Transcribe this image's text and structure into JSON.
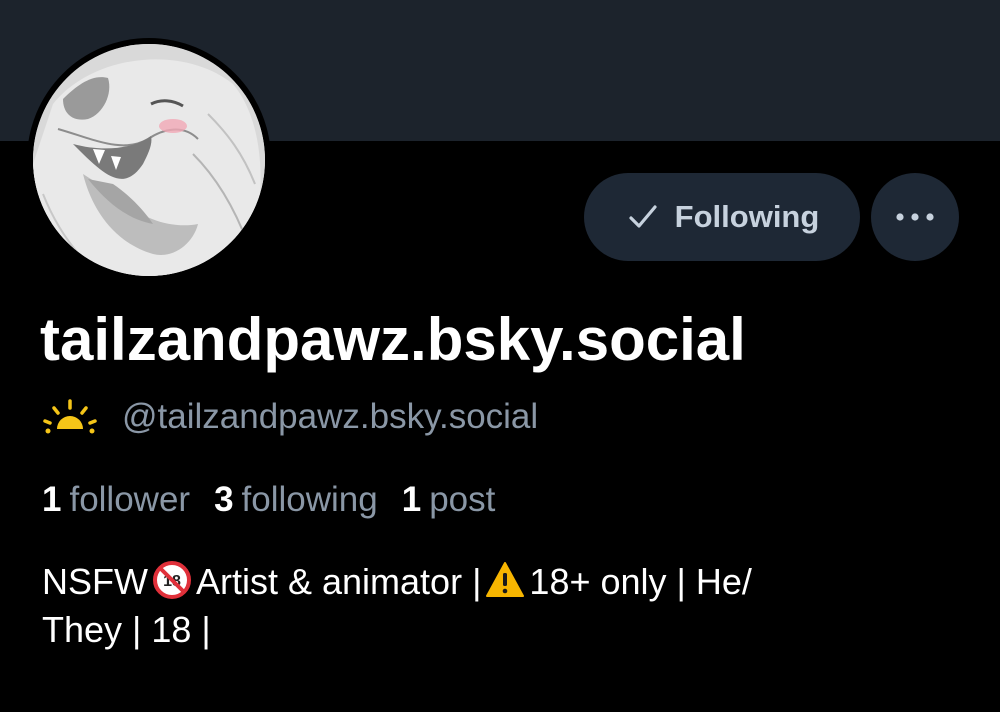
{
  "profile": {
    "display_name": "tailzandpawz.bsky.social",
    "handle": "@tailzandpawz.bsky.social",
    "handle_icon": "sunrise-icon"
  },
  "actions": {
    "following_label": "Following",
    "more_label": "More options"
  },
  "stats": {
    "followers_count": "1",
    "followers_label": "follower",
    "following_count": "3",
    "following_label": "following",
    "posts_count": "1",
    "posts_label": "post"
  },
  "bio": {
    "line1_part1": "NSFW",
    "line1_part2": "Artist & animator |",
    "line1_part3": "18+ only | He/",
    "line2": "They | 18 |",
    "icons": [
      "no-one-under-eighteen-icon",
      "warning-icon"
    ]
  },
  "colors": {
    "background": "#000000",
    "banner": "#1c232c",
    "button_bg": "#1e2835",
    "button_text": "#c7d2de",
    "muted_text": "#8a97a6",
    "primary_text": "#ffffff",
    "sun": "#f5c518"
  }
}
